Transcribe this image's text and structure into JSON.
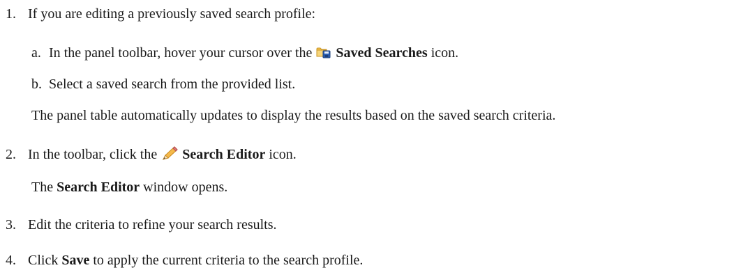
{
  "steps": [
    {
      "number": "1.",
      "text": "If you are editing a previously saved search profile:",
      "substeps": [
        {
          "letter": "a.",
          "before": "In the panel toolbar, hover your cursor over the",
          "icon": "saved-searches-icon",
          "bold": "Saved Searches",
          "after": "icon."
        },
        {
          "letter": "b.",
          "text": "Select a saved search from the provided list."
        }
      ],
      "result": "The panel table automatically updates to display the results based on the saved search criteria."
    },
    {
      "number": "2.",
      "before": "In the toolbar, click the",
      "icon": "search-editor-icon",
      "bold": "Search Editor",
      "after": "icon.",
      "result_before": "The",
      "result_bold": "Search Editor",
      "result_after": "window opens."
    },
    {
      "number": "3.",
      "text": "Edit the criteria to refine your search results."
    },
    {
      "number": "4.",
      "before": "Click",
      "bold": "Save",
      "after": "to apply the current criteria to the search profile."
    }
  ],
  "colors": {
    "text": "#1a1a1a",
    "folder_icon": "#f2c14e",
    "disk_icon": "#2b5fb3",
    "pencil_icon": "#e8a33c"
  }
}
